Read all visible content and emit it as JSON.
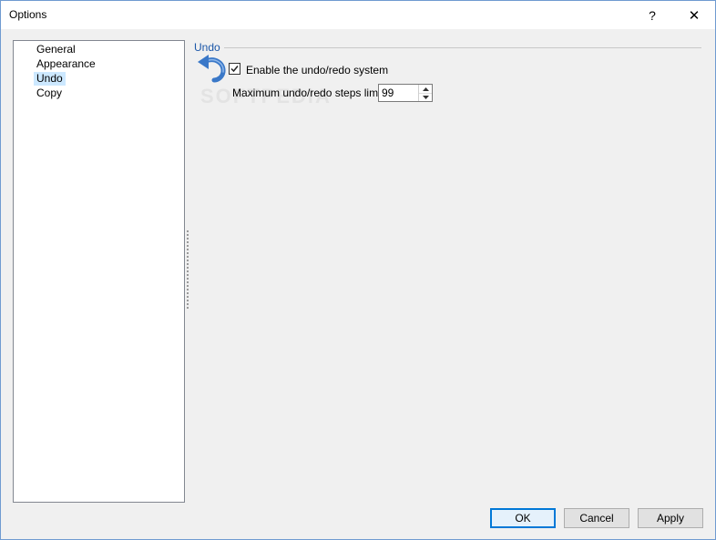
{
  "window": {
    "title": "Options",
    "help_label": "?",
    "close_label": "✕"
  },
  "sidebar": {
    "items": [
      {
        "label": "General"
      },
      {
        "label": "Appearance"
      },
      {
        "label": "Undo",
        "selected": true
      },
      {
        "label": "Copy"
      }
    ]
  },
  "undo_section": {
    "title": "Undo",
    "icon": "undo-arrow-icon",
    "enable_label": "Enable the undo/redo system",
    "enable_checked": true,
    "steps_label": "Maximum undo/redo steps limit:",
    "steps_value": "99"
  },
  "watermark": "SOFTPEDIA",
  "buttons": {
    "ok": "OK",
    "cancel": "Cancel",
    "apply": "Apply"
  },
  "colors": {
    "accent": "#0078d7",
    "section_title": "#1a56a8",
    "selection": "#cce8ff",
    "icon_blue": "#3a78c8"
  }
}
